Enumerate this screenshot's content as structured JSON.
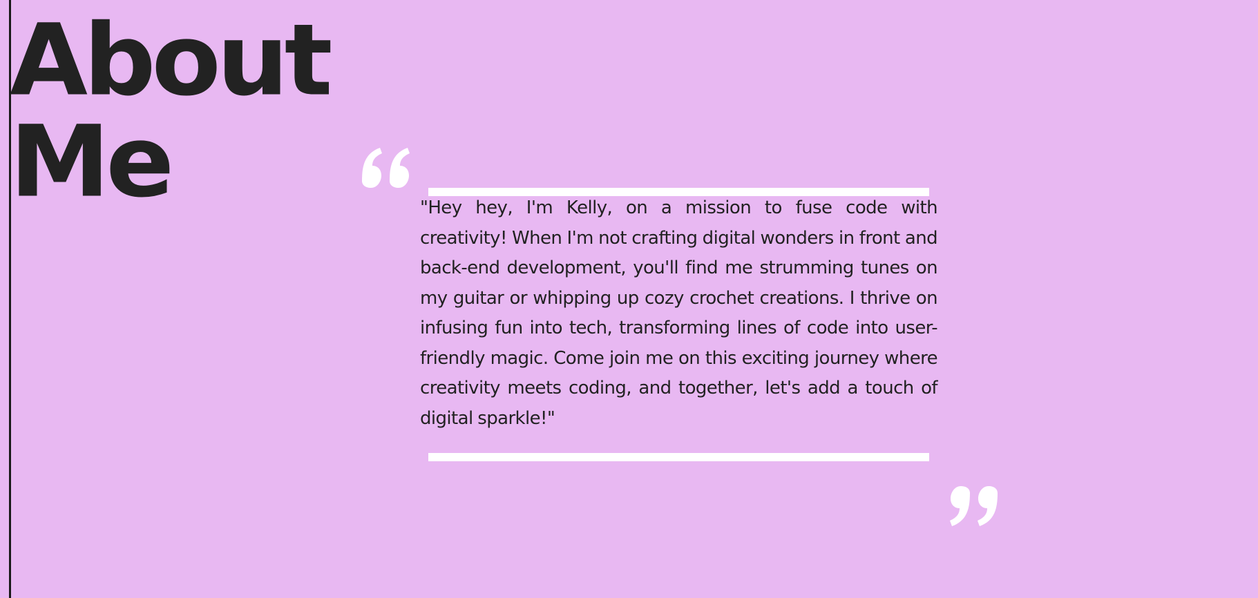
{
  "page": {
    "background_color": "#e8b8f2",
    "accent_color": "#ffffff",
    "text_color": "#222222"
  },
  "heading": {
    "line1": "About",
    "line2": "Me"
  },
  "quote": {
    "open_icon": "opening-quote-icon",
    "close_icon": "closing-quote-icon",
    "text": "\"Hey hey, I'm Kelly, on a mission to fuse code with creativity! When I'm not crafting digital wonders in front and back-end development, you'll find me strumming tunes on my guitar or whipping up cozy crochet creations. I thrive on infusing fun into tech, transforming lines of code into user-friendly magic. Come join me on this exciting journey where creativity meets coding, and together, let's add a touch of digital sparkle!\""
  }
}
